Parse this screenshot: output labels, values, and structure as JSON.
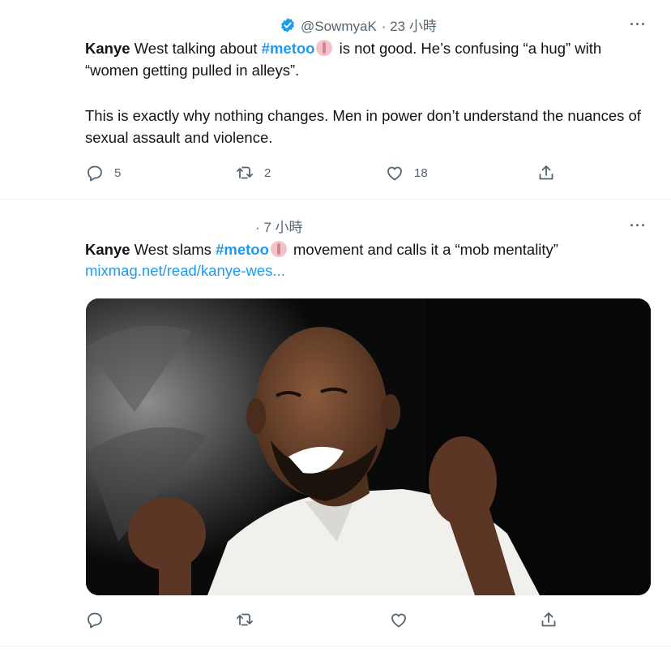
{
  "tweets": [
    {
      "handle": "@SowmyaK",
      "time": "· 23 小時",
      "text_p1": {
        "name": "Kanye",
        "before_tag": " West talking about ",
        "hashtag": "#metoo",
        "after_tag": " is not good. He’s confusing “a hug” with “women getting pulled in alleys”."
      },
      "text_p2": "This is exactly why nothing changes. Men in power don’t understand the nuances of sexual assault and violence.",
      "more": "···",
      "actions": {
        "reply": "5",
        "retweet": "2",
        "like": "18"
      }
    },
    {
      "time": "· 7 小時",
      "text": {
        "name": "Kanye",
        "before_tag": " West slams ",
        "hashtag": "#metoo",
        "after_tag": " movement and calls it a “mob mentality”"
      },
      "link": "mixmag.net/read/kanye-wes...",
      "more": "···"
    }
  ],
  "colors": {
    "accent": "#1d9bf0",
    "text": "#0f1419",
    "muted": "#536471",
    "divider": "#eff3f4"
  },
  "icons": [
    "verified-badge-icon",
    "more-icon",
    "reply-icon",
    "retweet-icon",
    "like-icon",
    "share-icon",
    "emoji-ribbon-icon"
  ]
}
